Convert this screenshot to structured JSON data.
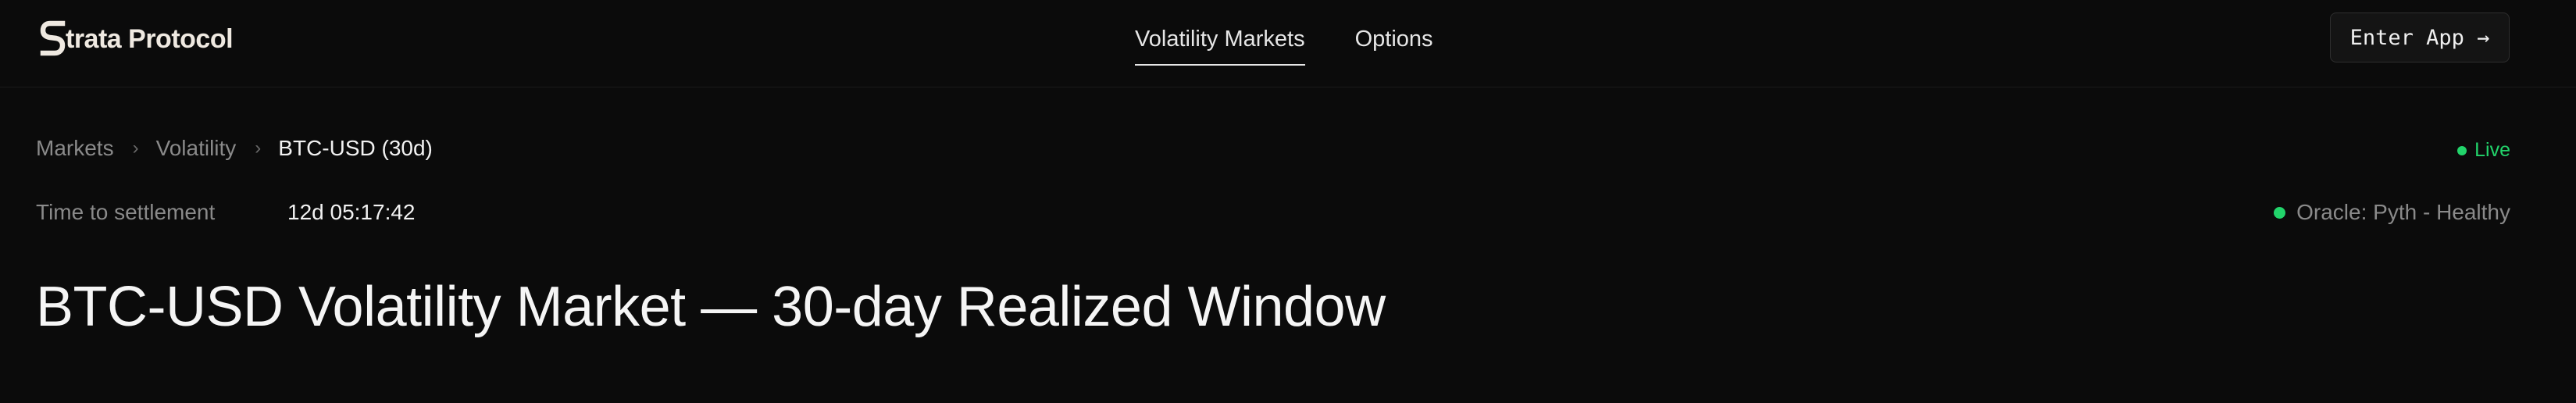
{
  "brand": {
    "name": "Strata Protocol",
    "logo_letter": "S",
    "logo_rest": "trata Protocol"
  },
  "nav": {
    "items": [
      {
        "label": "Volatility Markets",
        "active": true
      },
      {
        "label": "Options",
        "active": false
      }
    ]
  },
  "header": {
    "enter_app_label": "Enter App →"
  },
  "breadcrumb": {
    "items": [
      "Markets",
      "Volatility",
      "BTC-USD (30d)"
    ],
    "separator": "›"
  },
  "status": {
    "live_label": "Live",
    "oracle_label": "Oracle: Pyth - Healthy",
    "color": "#22d46b"
  },
  "settlement": {
    "label": "Time to settlement",
    "value": "12d 05:17:42"
  },
  "page": {
    "title": "BTC-USD Volatility Market — 30-day Realized Window"
  },
  "icons": {
    "logo": "strata-logo-icon",
    "live": "status-dot-icon",
    "oracle": "status-dot-icon"
  }
}
